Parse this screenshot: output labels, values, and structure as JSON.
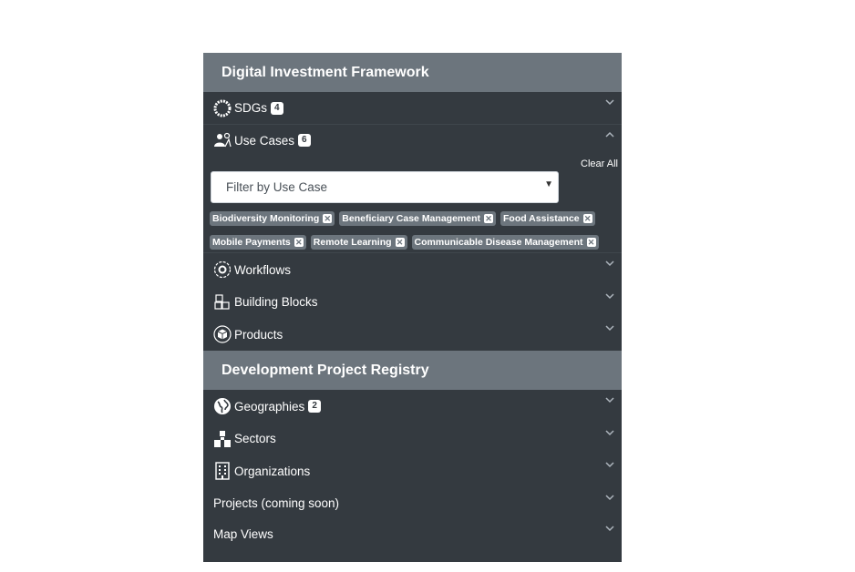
{
  "dif": {
    "title": "Digital Investment Framework",
    "sdgs": {
      "label": "SDGs",
      "count": "4"
    },
    "use_cases": {
      "label": "Use Cases",
      "count": "6",
      "clear_all": "Clear All",
      "filter_placeholder": "Filter by Use Case",
      "tags": [
        "Biodiversity Monitoring",
        "Beneficiary Case Management",
        "Food Assistance",
        "Mobile Payments",
        "Remote Learning",
        "Communicable Disease Management"
      ]
    },
    "workflows": "Workflows",
    "building_blocks": "Building Blocks",
    "products": "Products"
  },
  "dpr": {
    "title": "Development Project Registry",
    "geographies": {
      "label": "Geographies",
      "count": "2"
    },
    "sectors": "Sectors",
    "organizations": "Organizations",
    "projects": "Projects (coming soon)",
    "map_views": "Map Views"
  },
  "icons": {
    "sdgs": "sdg-wheel-icon",
    "use_cases": "users-icon",
    "workflows": "workflow-gear-icon",
    "building_blocks": "cubes-icon",
    "products": "product-box-icon",
    "geographies": "globe-icon",
    "sectors": "sectors-blocks-icon",
    "organizations": "building-icon"
  },
  "colors": {
    "panel": "#343a40",
    "header": "#6c757d",
    "tag": "#6c757d"
  }
}
